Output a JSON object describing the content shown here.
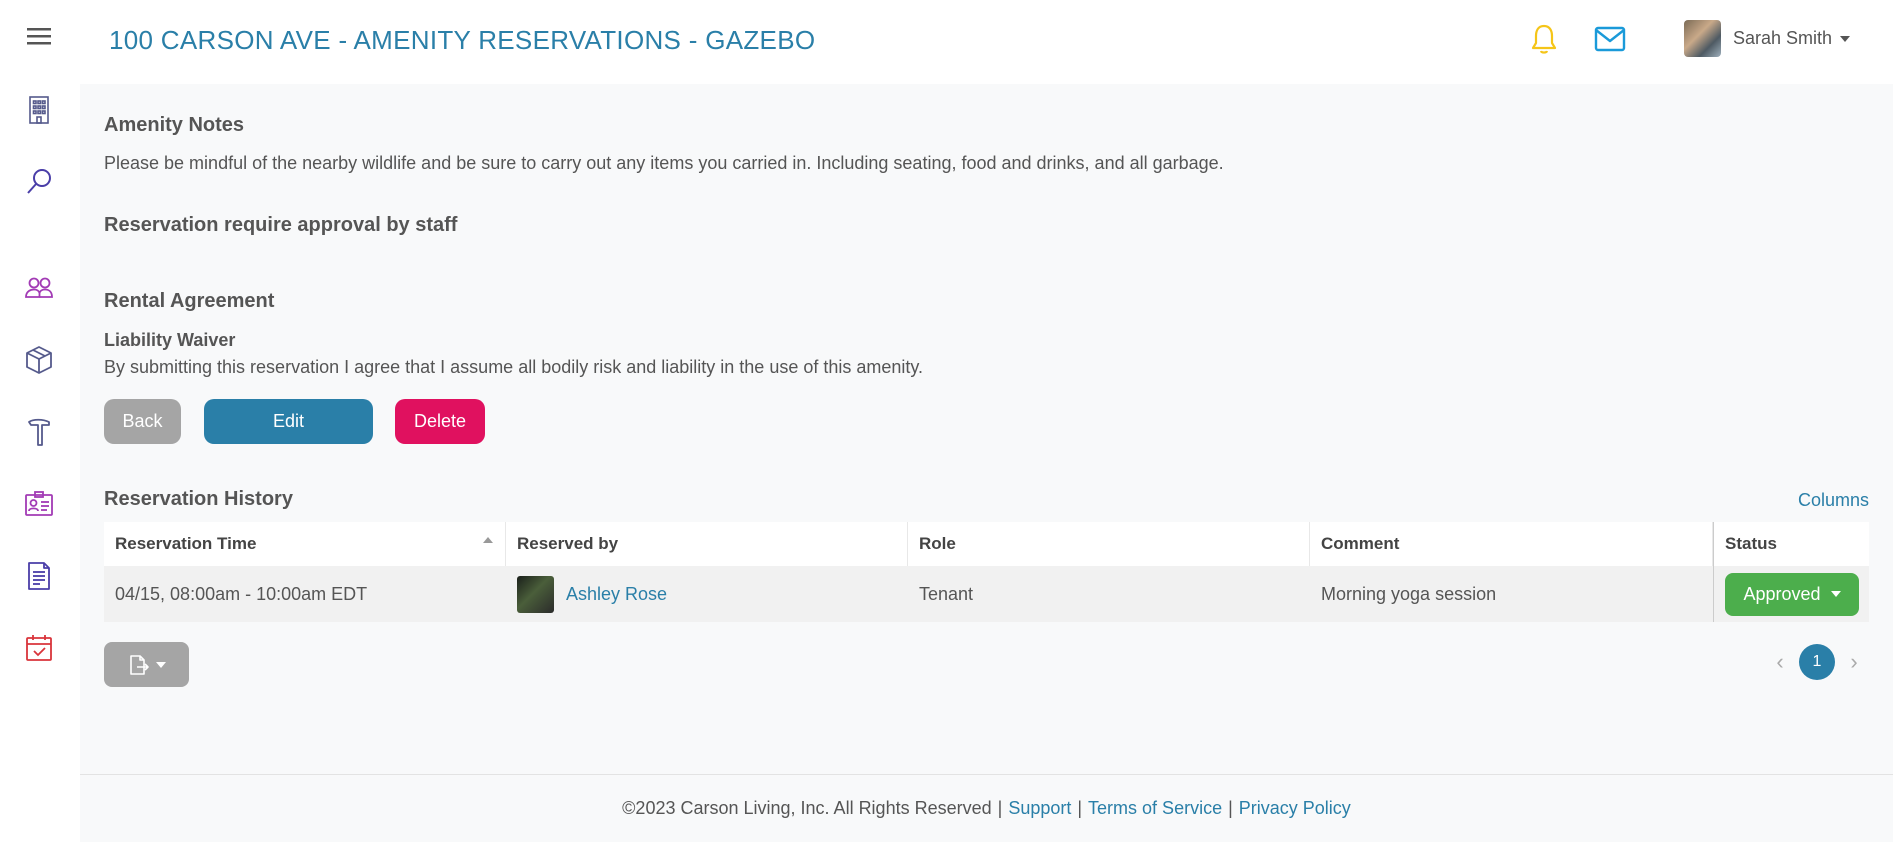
{
  "header": {
    "title": "100 CARSON AVE - AMENITY RESERVATIONS - GAZEBO",
    "user_name": "Sarah Smith"
  },
  "sidebar": {
    "icons": [
      "menu-icon",
      "building-icon",
      "search-icon",
      "users-icon",
      "package-icon",
      "hammer-icon",
      "id-card-icon",
      "document-icon",
      "calendar-check-icon"
    ]
  },
  "notes": {
    "heading": "Amenity Notes",
    "text": "Please be mindful of the nearby wildlife and be sure to carry out any items you carried in. Including seating, food and drinks, and all garbage."
  },
  "approval": {
    "heading": "Reservation require approval by staff"
  },
  "rental": {
    "heading": "Rental Agreement",
    "waiver_title": "Liability Waiver",
    "waiver_text": "By submitting this reservation I agree that I assume all bodily risk and liability in the use of this amenity."
  },
  "buttons": {
    "back": "Back",
    "edit": "Edit",
    "delete": "Delete"
  },
  "history": {
    "heading": "Reservation History",
    "columns_link": "Columns",
    "headers": [
      "Reservation Time",
      "Reserved by",
      "Role",
      "Comment",
      "Status"
    ],
    "rows": [
      {
        "time": "04/15, 08:00am - 10:00am EDT",
        "reserved_by": "Ashley Rose",
        "role": "Tenant",
        "comment": "Morning yoga session",
        "status": "Approved"
      }
    ]
  },
  "pagination": {
    "current_page": "1",
    "prev": "‹",
    "next": "›"
  },
  "footer": {
    "copyright": "©2023 Carson Living, Inc. All Rights Reserved",
    "support": "Support",
    "terms": "Terms of Service",
    "privacy": "Privacy Policy",
    "separator": "|"
  },
  "colors": {
    "accent": "#2a7fa8",
    "danger": "#e0115f",
    "success": "#4cae4c",
    "neutral": "#a5a5a5",
    "bell": "#f5c518"
  }
}
